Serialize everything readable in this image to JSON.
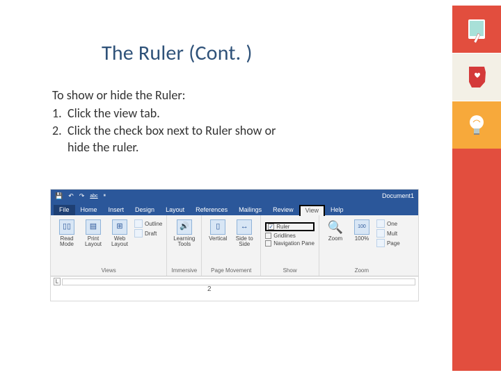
{
  "title": "The Ruler (Cont. )",
  "body": {
    "lead": "To show or hide the Ruler:",
    "step1": "Click the view tab.",
    "step2a": "Click the check box next to Ruler show or",
    "step2b": "hide the ruler."
  },
  "sidebar": {
    "icon1": "tablet-touch-icon",
    "icon2": "ohio-heart-icon",
    "icon3": "lightbulb-icon"
  },
  "word": {
    "docname": "Document1",
    "qat": {
      "save": "💾",
      "undo": "↶",
      "redo": "↷",
      "spell": "abc",
      "pause": "⏸"
    },
    "tabs": [
      "File",
      "Home",
      "Insert",
      "Design",
      "Layout",
      "References",
      "Mailings",
      "Review",
      "View",
      "Help"
    ],
    "groups": {
      "views": {
        "label": "Views",
        "read": "Read Mode",
        "print": "Print Layout",
        "web": "Web Layout",
        "outline": "Outline",
        "draft": "Draft"
      },
      "immersive": {
        "label": "Immersive",
        "learning": "Learning Tools"
      },
      "pagemove": {
        "label": "Page Movement",
        "vertical": "Vertical",
        "side": "Side to Side"
      },
      "show": {
        "label": "Show",
        "ruler": "Ruler",
        "gridlines": "Gridlines",
        "nav": "Navigation Pane"
      },
      "zoom": {
        "label": "Zoom",
        "zoom": "Zoom",
        "hundred": "100%",
        "one": "One",
        "mult": "Mult",
        "page": "Page"
      }
    },
    "ruler_tab": "L",
    "ruler_marker": "2"
  }
}
